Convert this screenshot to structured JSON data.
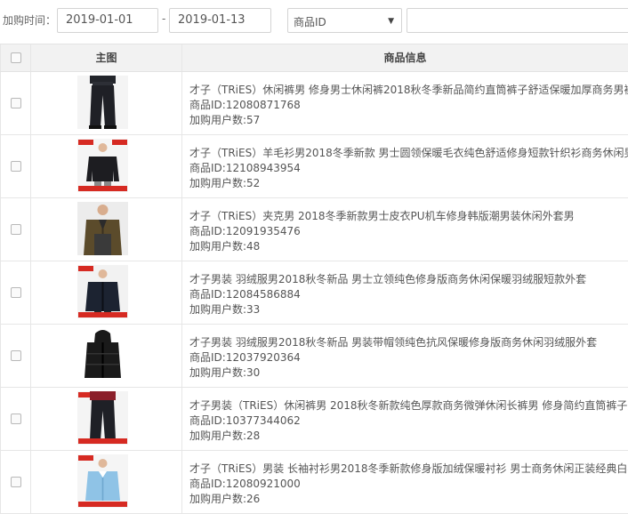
{
  "filter": {
    "label": "加购时间：",
    "start_date": "2019-01-01",
    "separator": "-",
    "end_date": "2019-01-13",
    "field_select": "商品ID",
    "search_value": ""
  },
  "table": {
    "headers": [
      "主图",
      "商品信息"
    ],
    "rows": [
      {
        "title": "才子（TRiES）休闲裤男 修身男士休闲裤2018秋冬季新品简约直筒裤子舒适保暖加厚商务男裤",
        "id_line": "商品ID:12080871768",
        "users_line": "加购用户数:57",
        "thumb": "pants"
      },
      {
        "title": "才子（TRiES）羊毛衫男2018冬季新款 男士圆领保暖毛衣纯色舒适修身短款针织衫商务休闲男装",
        "id_line": "商品ID:12108943954",
        "users_line": "加购用户数:52",
        "thumb": "sweater"
      },
      {
        "title": "才子（TRiES）夹克男 2018冬季新款男士皮衣PU机车修身韩版潮男装休闲外套男",
        "id_line": "商品ID:12091935476",
        "users_line": "加购用户数:48",
        "thumb": "jacket"
      },
      {
        "title": "才子男装 羽绒服男2018秋冬新品 男士立领纯色修身版商务休闲保暖羽绒服短款外套",
        "id_line": "商品ID:12084586884",
        "users_line": "加购用户数:33",
        "thumb": "down-short"
      },
      {
        "title": "才子男装 羽绒服男2018秋冬新品 男装带帽领纯色抗风保暖修身版商务休闲羽绒服外套",
        "id_line": "商品ID:12037920364",
        "users_line": "加购用户数:30",
        "thumb": "down-hood"
      },
      {
        "title": "才子男装（TRiES）休闲裤男 2018秋冬新款纯色厚款商务微弹休闲长裤男 修身简约直筒裤子男",
        "id_line": "商品ID:10377344062",
        "users_line": "加购用户数:28",
        "thumb": "pants2"
      },
      {
        "title": "才子（TRiES）男装 长袖衬衫男2018冬季新款修身版加绒保暖衬衫 男士商务休闲正装经典白衬",
        "id_line": "商品ID:12080921000",
        "users_line": "加购用户数:26",
        "thumb": "shirt"
      }
    ]
  }
}
